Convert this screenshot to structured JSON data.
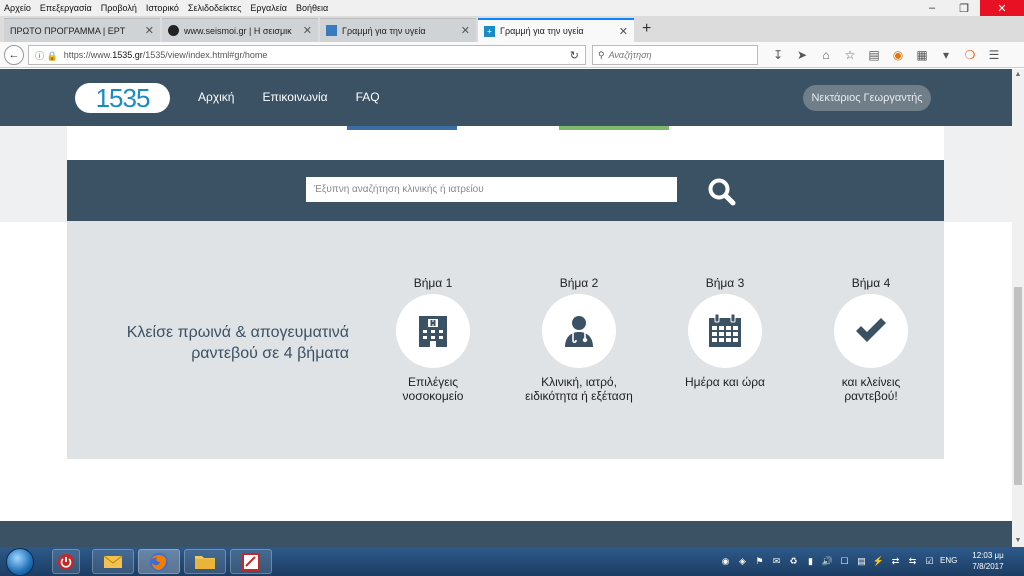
{
  "menubar": {
    "items": [
      "Αρχείο",
      "Επεξεργασία",
      "Προβολή",
      "Ιστορικό",
      "Σελιδοδείκτες",
      "Εργαλεία",
      "Βοήθεια"
    ]
  },
  "window_controls": {
    "minimize": "–",
    "restore": "❐",
    "close": "✕"
  },
  "tabs": [
    {
      "label": "ΠΡΩΤΟ ΠΡΟΓΡΑΜΜΑ | ΕΡΤ",
      "close": "✕"
    },
    {
      "label": "www.seismoi.gr | Η σεισμικ",
      "close": "✕"
    },
    {
      "label": "Γραμμή για την υγεία",
      "close": "✕"
    },
    {
      "label": "Γραμμή για την υγεία",
      "close": "✕"
    }
  ],
  "new_tab": "+",
  "navbar": {
    "url_prefix": "https://www.",
    "url_domain": "1535.gr",
    "url_path": "/1535/view/index.html#gr/home",
    "search_placeholder": "Αναζήτηση"
  },
  "site": {
    "logo": "1535",
    "nav": [
      "Αρχική",
      "Επικοινωνία",
      "FAQ"
    ],
    "user": "Νεκτάριος Γεωργαντής",
    "search_placeholder": "Έξυπνη αναζήτηση κλινικής ή ιατρείου",
    "tagline_line1": "Κλείσε πρωινά & απογευματινά",
    "tagline_line2": "ραντεβού σε 4 βήματα",
    "steps": [
      {
        "title": "Βήμα 1",
        "line1": "Επιλέγεις",
        "line2": "νοσοκομείο",
        "icon": "hospital-icon"
      },
      {
        "title": "Βήμα 2",
        "line1": "Κλινική, ιατρό,",
        "line2": "ειδικότητα ή εξέταση",
        "icon": "doctor-icon"
      },
      {
        "title": "Βήμα 3",
        "line1": "Ημέρα και ώρα",
        "line2": "",
        "icon": "calendar-icon"
      },
      {
        "title": "Βήμα 4",
        "line1": "και κλείνεις",
        "line2": "ραντεβού!",
        "icon": "checkmark-icon"
      }
    ]
  },
  "taskbar": {
    "language": "ENG",
    "time": "12:03 μμ",
    "date": "7/8/2017"
  },
  "colors": {
    "header": "#3b5264",
    "steps_bg": "#dfe3e6",
    "logo_text": "#1a8bc4",
    "active_tab_accent": "#0a84ff"
  }
}
